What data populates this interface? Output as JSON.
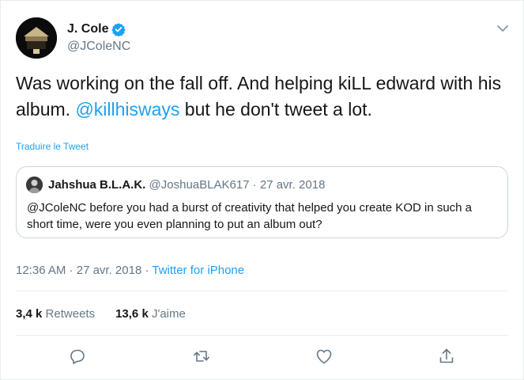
{
  "author": {
    "name": "J. Cole",
    "handle": "@JColeNC"
  },
  "tweet": {
    "text_part1": "Was working on the fall off. And helping kiLL edward with his album. ",
    "mention": "@killhisways",
    "text_part2": " but he don't tweet a lot."
  },
  "translate_label": "Traduire le Tweet",
  "quoted": {
    "name": "Jahshua B.L.A.K.",
    "handle": "@JoshuaBLAK617",
    "separator": " · ",
    "date": "27 avr. 2018",
    "text": "@JColeNC before you had a burst of creativity that helped you create KOD in such a short time, were you even planning to put an album out?"
  },
  "meta": {
    "time": "12:36 AM",
    "separator1": " · ",
    "date": "27 avr. 2018",
    "separator2": " · ",
    "source": "Twitter for iPhone"
  },
  "stats": {
    "retweets_count": "3,4 k",
    "retweets_label": "Retweets",
    "likes_count": "13,6 k",
    "likes_label": "J'aime"
  },
  "icons": {
    "reply": "reply-icon",
    "retweet": "retweet-icon",
    "like": "heart-icon",
    "share": "share-icon",
    "verified": "verified-badge-icon",
    "caret": "chevron-down-icon"
  },
  "colors": {
    "accent": "#1da1f2",
    "text": "#14171a",
    "muted": "#657786",
    "border": "#e6ecf0"
  }
}
